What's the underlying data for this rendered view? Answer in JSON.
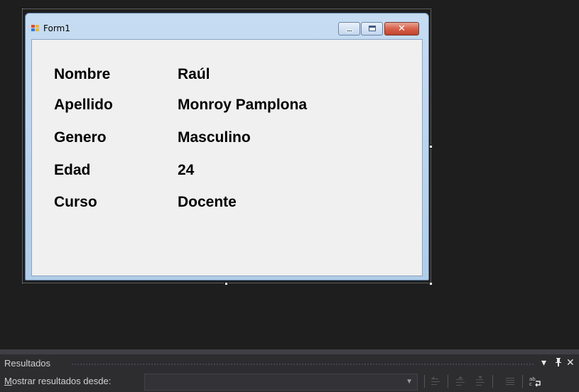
{
  "form": {
    "title": "Form1",
    "close_glyph": "✕",
    "fields": [
      {
        "label": "Nombre",
        "value": "Raúl"
      },
      {
        "label": "Apellido",
        "value": "Monroy Pamplona"
      },
      {
        "label": "Genero",
        "value": "Masculino"
      },
      {
        "label": "Edad",
        "value": "24"
      },
      {
        "label": "Curso",
        "value": "Docente"
      }
    ]
  },
  "results_panel": {
    "title": "Resultados",
    "show_output_from_prefix": "M",
    "show_output_from_rest": "ostrar resultados desde:",
    "source_value": "",
    "header_icons": [
      "dropdown-arrow-icon",
      "pin-icon",
      "close-icon"
    ],
    "toolbar_icons": [
      "find-previous-icon",
      "go-to-previous-icon",
      "go-to-next-icon",
      "clear-all-icon",
      "word-wrap-icon"
    ],
    "pin_glyph": "ᵽ",
    "close_glyph": "✕",
    "dropdown_glyph": "▾"
  }
}
